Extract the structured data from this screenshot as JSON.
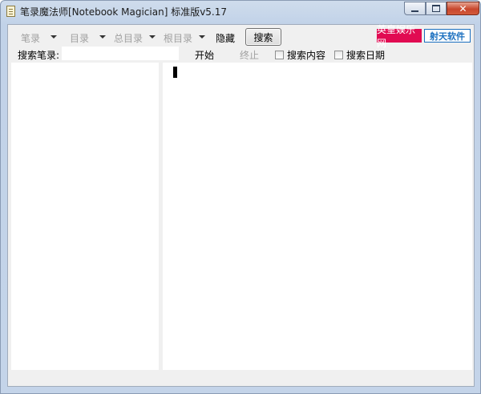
{
  "window": {
    "title": "笔录魔法师[Notebook Magician] 标准版v5.17"
  },
  "toolbar": {
    "notes_label": "笔录",
    "catalog_label": "目录",
    "master_catalog_label": "总目录",
    "root_catalog_label": "根目录",
    "hide_label": "隐藏",
    "search_button_label": "搜索"
  },
  "ads": {
    "ad1_text": "英皇娱乐网",
    "ad2_text": "射天软件"
  },
  "search_row": {
    "label": "搜索笔录:",
    "input_value": "",
    "start_label": "开始",
    "stop_label": "终止",
    "search_content_label": "搜索内容",
    "search_content_checked": false,
    "search_date_label": "搜索日期",
    "search_date_checked": false
  },
  "colors": {
    "ad1_bg": "#e10b52",
    "ad2_border": "#1a6fbf",
    "client_bg": "#f0f0f0"
  }
}
